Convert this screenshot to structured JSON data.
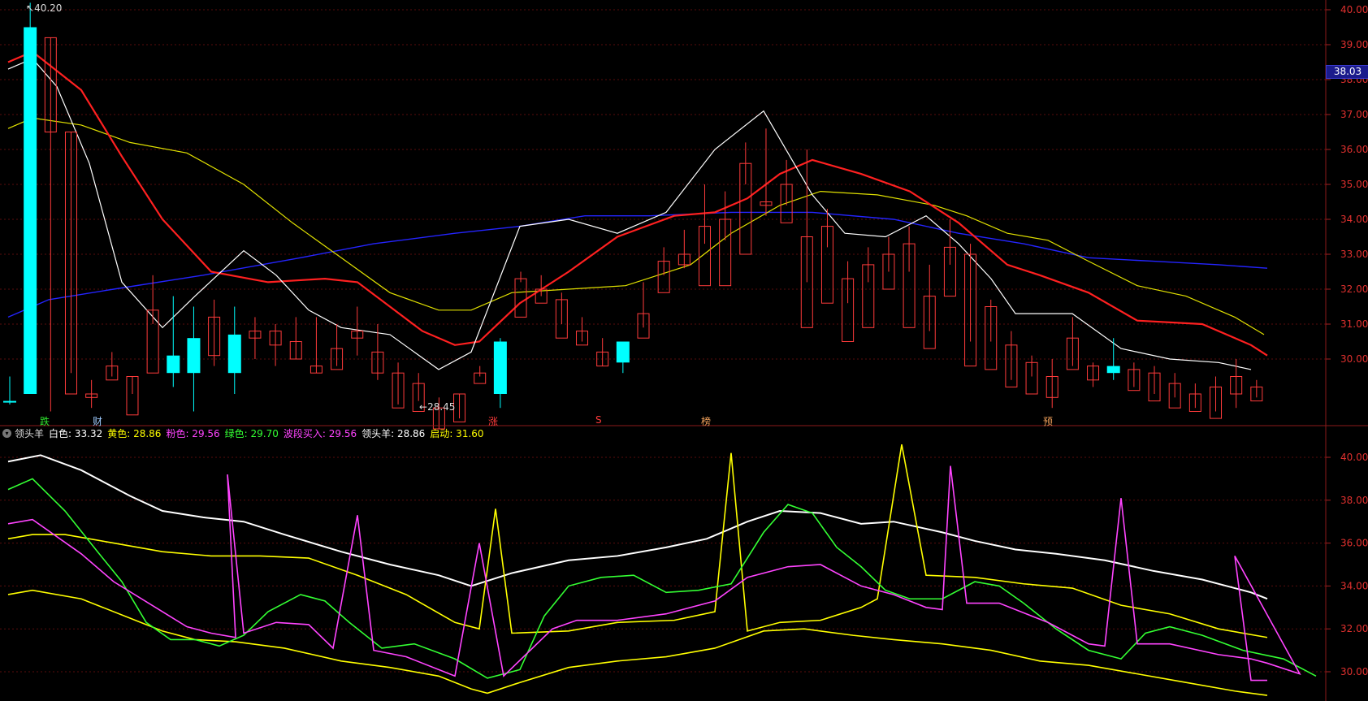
{
  "price_axis": {
    "labels": [
      "40.00",
      "39.00",
      "38.00",
      "37.00",
      "36.00",
      "35.00",
      "34.00",
      "33.00",
      "32.00",
      "31.00",
      "30.00"
    ]
  },
  "current_price": "38.03",
  "annotations": {
    "high": "40.20",
    "low": "28.45"
  },
  "markers": [
    {
      "text": "跌",
      "color": "#2ee62e"
    },
    {
      "text": "财",
      "color": "#9ecbff"
    },
    {
      "text": "涨",
      "color": "#ff3b3b"
    },
    {
      "text": "S",
      "color": "#ff3b3b"
    },
    {
      "text": "榜",
      "color": "#f0a05a"
    },
    {
      "text": "预",
      "color": "#f0a05a"
    }
  ],
  "indicator": {
    "name": "领头羊",
    "items": [
      {
        "label": "白色: 33.32",
        "color": "#ffffff"
      },
      {
        "label": "黄色: 28.86",
        "color": "#ffff00"
      },
      {
        "label": "粉色: 29.56",
        "color": "#ff44ff"
      },
      {
        "label": "绿色: 29.70",
        "color": "#33ff33"
      },
      {
        "label": "波段买入: 29.56",
        "color": "#ff44ff"
      },
      {
        "label": "领头羊: 28.86",
        "color": "#ffffff"
      },
      {
        "label": "启动: 31.60",
        "color": "#ffff00"
      }
    ]
  },
  "indicator_axis": {
    "labels": [
      "40.00",
      "38.00",
      "36.00",
      "34.00",
      "32.00",
      "30.00"
    ]
  },
  "chart_data": {
    "type": "candlestick",
    "ylim": [
      28.0,
      40.3
    ],
    "candles": [
      [
        28.8,
        29.5,
        28.7,
        28.8
      ],
      [
        29.0,
        40.2,
        29.0,
        39.5
      ],
      [
        39.2,
        39.2,
        28.5,
        36.5
      ],
      [
        36.5,
        36.5,
        29.6,
        29.0
      ],
      [
        29.0,
        29.4,
        28.6,
        28.9
      ],
      [
        29.8,
        30.2,
        29.5,
        29.4
      ],
      [
        29.5,
        29.5,
        29.0,
        28.4
      ],
      [
        31.4,
        32.4,
        31.0,
        29.6
      ],
      [
        29.6,
        31.8,
        29.2,
        30.1
      ],
      [
        29.6,
        31.5,
        28.5,
        30.6
      ],
      [
        31.2,
        31.7,
        29.8,
        30.1
      ],
      [
        29.6,
        31.5,
        29.0,
        30.7
      ],
      [
        30.8,
        31.2,
        30.0,
        30.6
      ],
      [
        30.8,
        31.0,
        29.8,
        30.4
      ],
      [
        30.5,
        31.2,
        30.0,
        30.0
      ],
      [
        29.8,
        31.2,
        29.6,
        29.6
      ],
      [
        30.3,
        31.0,
        29.8,
        29.7
      ],
      [
        30.8,
        31.5,
        30.1,
        30.6
      ],
      [
        30.2,
        31.0,
        29.4,
        29.6
      ],
      [
        29.6,
        29.9,
        28.7,
        28.6
      ],
      [
        29.3,
        29.6,
        28.8,
        28.5
      ],
      [
        28.6,
        28.9,
        28.0,
        28.0
      ],
      [
        29.0,
        29.0,
        28.3,
        28.2
      ],
      [
        29.6,
        29.8,
        29.5,
        29.3
      ],
      [
        29.0,
        30.6,
        28.6,
        30.5
      ],
      [
        32.3,
        32.5,
        32.2,
        31.2
      ],
      [
        32.0,
        32.4,
        31.8,
        31.6
      ],
      [
        31.7,
        31.9,
        31.0,
        30.6
      ],
      [
        30.8,
        31.2,
        30.5,
        30.4
      ],
      [
        30.2,
        30.6,
        29.8,
        29.8
      ],
      [
        29.9,
        30.5,
        29.6,
        30.5
      ],
      [
        31.3,
        32.2,
        30.9,
        30.6
      ],
      [
        32.8,
        33.2,
        32.4,
        31.9
      ],
      [
        33.0,
        33.7,
        32.6,
        32.7
      ],
      [
        33.8,
        35.0,
        33.3,
        32.1
      ],
      [
        34.0,
        34.8,
        33.4,
        32.1
      ],
      [
        35.6,
        36.2,
        35.0,
        33.0
      ],
      [
        34.5,
        36.6,
        34.1,
        34.4
      ],
      [
        35.0,
        35.7,
        34.4,
        33.9
      ],
      [
        33.5,
        36.0,
        32.2,
        30.9
      ],
      [
        33.8,
        34.3,
        33.2,
        31.6
      ],
      [
        32.3,
        32.8,
        31.6,
        30.5
      ],
      [
        32.7,
        33.2,
        32.2,
        30.9
      ],
      [
        33.0,
        33.5,
        32.5,
        32.0
      ],
      [
        33.3,
        33.8,
        32.5,
        30.9
      ],
      [
        31.8,
        32.7,
        30.8,
        30.3
      ],
      [
        33.2,
        34.0,
        32.7,
        31.8
      ],
      [
        33.0,
        33.3,
        30.5,
        29.8
      ],
      [
        31.5,
        31.7,
        30.5,
        29.7
      ],
      [
        30.4,
        30.8,
        29.4,
        29.2
      ],
      [
        29.9,
        30.1,
        29.5,
        29.0
      ],
      [
        29.5,
        30.0,
        28.6,
        28.9
      ],
      [
        30.6,
        31.2,
        29.8,
        29.7
      ],
      [
        29.8,
        29.9,
        29.2,
        29.4
      ],
      [
        29.6,
        30.6,
        29.4,
        29.8
      ],
      [
        29.7,
        29.9,
        29.2,
        29.1
      ],
      [
        29.6,
        29.8,
        29.0,
        28.8
      ],
      [
        29.3,
        29.6,
        28.9,
        28.6
      ],
      [
        29.0,
        29.3,
        28.6,
        28.5
      ],
      [
        29.2,
        29.5,
        28.5,
        28.3
      ],
      [
        29.5,
        30.0,
        28.6,
        29.0
      ],
      [
        29.2,
        29.4,
        28.9,
        28.8
      ]
    ],
    "series": [
      {
        "name": "白色",
        "color": "#ffffff"
      },
      {
        "name": "黄色",
        "color": "#ffff00"
      },
      {
        "name": "粉色",
        "color": "#ff44ff"
      },
      {
        "name": "绿色",
        "color": "#33ff33"
      }
    ]
  }
}
